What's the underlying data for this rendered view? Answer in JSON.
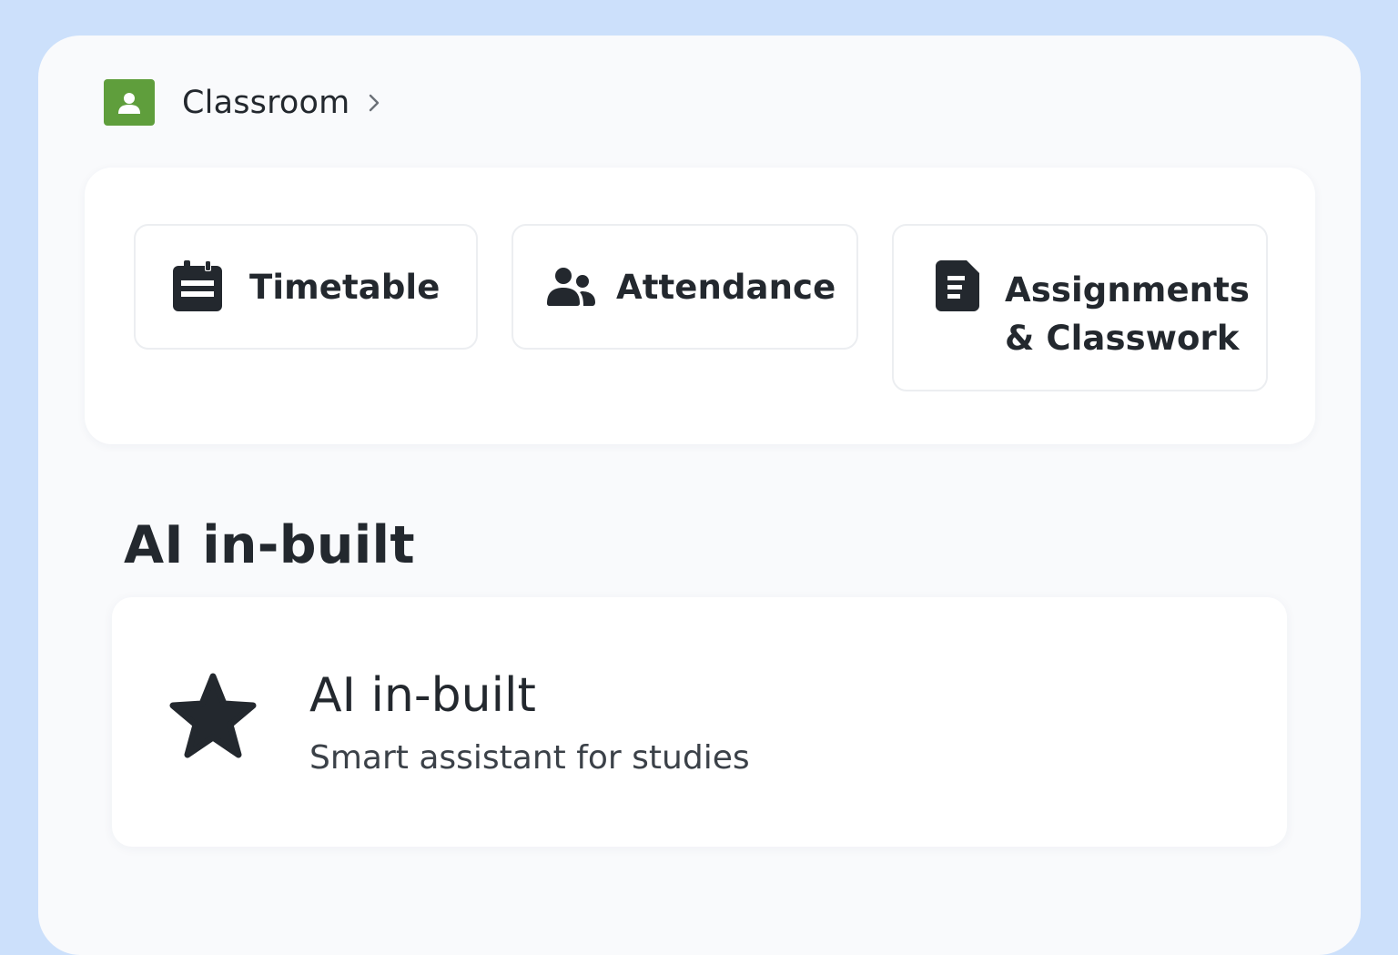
{
  "breadcrumb": {
    "app_icon": "classroom-person-icon",
    "label": "Classroom",
    "chevron_icon": "chevron-right-icon"
  },
  "tools": [
    {
      "label": "Timetable",
      "icon": "calendar-icon"
    },
    {
      "label": "Attendance",
      "icon": "users-icon"
    },
    {
      "label_line1": "Assignments",
      "label_line2": "& Classwork",
      "icon": "document-icon"
    }
  ],
  "ai_section": {
    "heading": "AI in-built",
    "card": {
      "icon": "star-icon",
      "title": "AI in-built",
      "subtitle": "Smart assistant for studies"
    }
  },
  "colors": {
    "page_background": "#cce0fb",
    "window_background": "#f9fafc",
    "app_logo": "#5f9e3c",
    "text_primary": "#23282e"
  }
}
